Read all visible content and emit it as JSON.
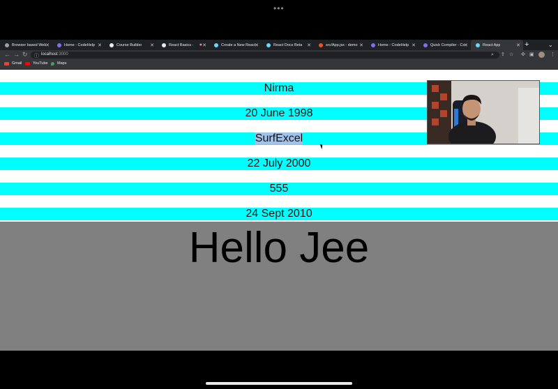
{
  "browser": {
    "tabs": [
      {
        "title": "Browser based Web",
        "active": false
      },
      {
        "title": "Home - CodeHelp",
        "active": false
      },
      {
        "title": "Course Builder",
        "active": false
      },
      {
        "title": "React Basics -",
        "active": false
      },
      {
        "title": "Create a New React",
        "active": false
      },
      {
        "title": "React Docs Beta",
        "active": false
      },
      {
        "title": "src/App.jsx - demo",
        "active": false
      },
      {
        "title": "Home - CodeHelp",
        "active": false
      },
      {
        "title": "Quick Compiler - Co",
        "active": false
      },
      {
        "title": "React App",
        "active": true
      }
    ],
    "url_host": "localhost",
    "url_port": ":3000",
    "bookmarks": [
      {
        "label": "Gmail",
        "color": "#ea4335"
      },
      {
        "label": "YouTube",
        "color": "#ff0000"
      },
      {
        "label": "Maps",
        "color": "#34a853"
      }
    ]
  },
  "page": {
    "items": [
      {
        "text": "Nirma"
      },
      {
        "text": "20 June 1998"
      },
      {
        "text": "SurfExcel"
      },
      {
        "text": "22 July 2000"
      },
      {
        "text": "555"
      },
      {
        "text": "24 Sept 2010"
      }
    ],
    "heading": "Hello Jee",
    "stripe_color": "#00ffff",
    "grey_color": "#808080"
  }
}
